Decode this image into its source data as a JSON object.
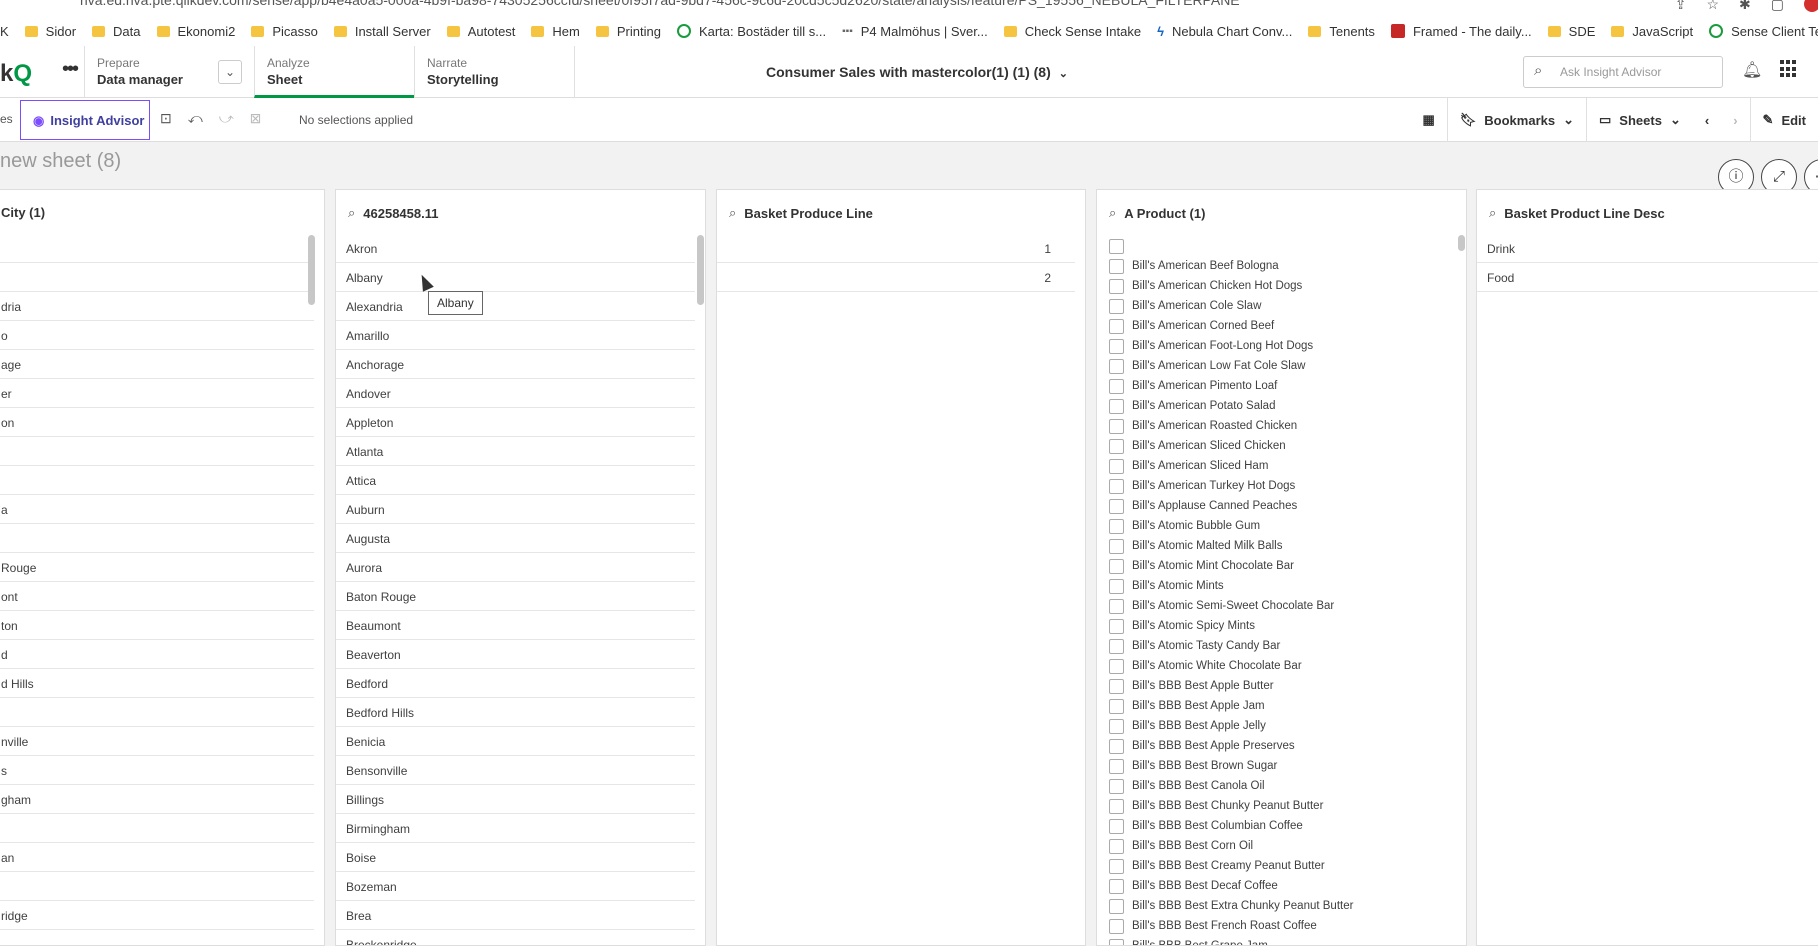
{
  "browser": {
    "url": "riva.ed.riva.pte.qlikdev.com/sense/app/b4e4a0a5-000a-4b9f-ba98-74305256ccfd/sheet/0f95f7ad-9bd7-456c-9c6d-20cd5c5d2620/state/analysis/feature/PS_19556_NEBULA_FILTERPANE",
    "bookmarks": [
      "K",
      "Sidor",
      "Data",
      "Ekonomi2",
      "Picasso",
      "Install Server",
      "Autotest",
      "Hem",
      "Printing",
      "Karta: Bostäder till s...",
      "P4 Malmöhus | Sver...",
      "Check Sense Intake",
      "Nebula Chart Conv...",
      "Tenents",
      "Framed - The daily...",
      "SDE",
      "JavaScript",
      "Sense Client Tests |..."
    ]
  },
  "header": {
    "logo_text": "k",
    "logo_q": "Q",
    "prepare_sub": "Prepare",
    "prepare_main": "Data manager",
    "analyze_sub": "Analyze",
    "analyze_main": "Sheet",
    "narrate_sub": "Narrate",
    "narrate_main": "Storytelling",
    "app_title": "Consumer Sales with mastercolor(1) (1) (8)",
    "ask_placeholder": "Ask Insight Advisor"
  },
  "toolbar": {
    "left_fragment": "es",
    "insight_label": "Insight Advisor",
    "no_selections": "No selections applied",
    "bookmarks_label": "Bookmarks",
    "sheets_label": "Sheets",
    "edit_label": "Edit"
  },
  "sheet": {
    "title": "new sheet (8)"
  },
  "panels": {
    "city": {
      "title": "City (1)",
      "rows": [
        "",
        "",
        "dria",
        "o",
        "age",
        "er",
        "on",
        "",
        "",
        "a",
        "",
        "Rouge",
        "ont",
        "ton",
        "d",
        "d Hills",
        "",
        "nville",
        "s",
        "gham",
        "",
        "an",
        "",
        "ridge"
      ]
    },
    "search": {
      "title": "46258458.11",
      "rows": [
        "Akron",
        "Albany",
        "Alexandria",
        "Amarillo",
        "Anchorage",
        "Andover",
        "Appleton",
        "Atlanta",
        "Attica",
        "Auburn",
        "Augusta",
        "Aurora",
        "Baton Rouge",
        "Beaumont",
        "Beaverton",
        "Bedford",
        "Bedford Hills",
        "Benicia",
        "Bensonville",
        "Billings",
        "Birmingham",
        "Boise",
        "Bozeman",
        "Brea",
        "Breckenridge"
      ]
    },
    "basket_line": {
      "title": "Basket Produce Line",
      "rows": [
        "1",
        "2"
      ]
    },
    "product": {
      "title": "A Product (1)",
      "rows": [
        "",
        "Bill's American Beef Bologna",
        "Bill's American Chicken Hot Dogs",
        "Bill's American Cole Slaw",
        "Bill's American Corned Beef",
        "Bill's American Foot-Long Hot Dogs",
        "Bill's American Low Fat Cole Slaw",
        "Bill's American Pimento Loaf",
        "Bill's American Potato Salad",
        "Bill's American Roasted Chicken",
        "Bill's American Sliced Chicken",
        "Bill's American Sliced Ham",
        "Bill's American Turkey Hot Dogs",
        "Bill's Applause Canned Peaches",
        "Bill's Atomic Bubble Gum",
        "Bill's Atomic Malted Milk Balls",
        "Bill's Atomic Mint Chocolate Bar",
        "Bill's Atomic Mints",
        "Bill's Atomic Semi-Sweet Chocolate Bar",
        "Bill's Atomic Spicy Mints",
        "Bill's Atomic Tasty Candy Bar",
        "Bill's Atomic White Chocolate Bar",
        "Bill's BBB Best Apple Butter",
        "Bill's BBB Best Apple Jam",
        "Bill's BBB Best Apple Jelly",
        "Bill's BBB Best Apple Preserves",
        "Bill's BBB Best Brown Sugar",
        "Bill's BBB Best Canola Oil",
        "Bill's BBB Best Chunky Peanut Butter",
        "Bill's BBB Best Columbian Coffee",
        "Bill's BBB Best Corn Oil",
        "Bill's BBB Best Creamy Peanut Butter",
        "Bill's BBB Best Decaf Coffee",
        "Bill's BBB Best Extra Chunky Peanut Butter",
        "Bill's BBB Best French Roast Coffee",
        "Bill's BBB Best Grape Jam"
      ]
    },
    "basket_desc": {
      "title": "Basket Product Line Desc",
      "rows": [
        "Drink",
        "Food"
      ]
    }
  },
  "tooltip": {
    "text": "Albany"
  }
}
